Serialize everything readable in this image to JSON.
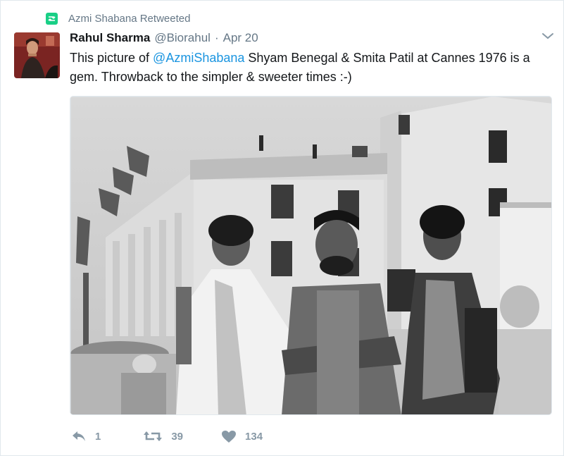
{
  "retweet_bar": {
    "label": "Azmi Shabana Retweeted",
    "icon": "retweet-icon",
    "color": "#19cf86"
  },
  "tweet": {
    "author_name": "Rahul Sharma",
    "author_handle": "@Biorahul",
    "separator": "·",
    "date": "Apr 20",
    "text_before": "This picture of ",
    "mention": "@AzmiShabana",
    "text_after": " Shyam Benegal & Smita Patil at Cannes 1976 is a gem. Throwback to the simpler & sweeter times :-)",
    "mention_color": "#1b95e0",
    "photo_icon": "photo"
  },
  "actions": {
    "reply_count": "1",
    "retweet_count": "39",
    "like_count": "134",
    "icons": [
      "reply-icon",
      "retweet-icon",
      "heart-icon"
    ]
  },
  "menu_icon": "chevron-down-icon"
}
